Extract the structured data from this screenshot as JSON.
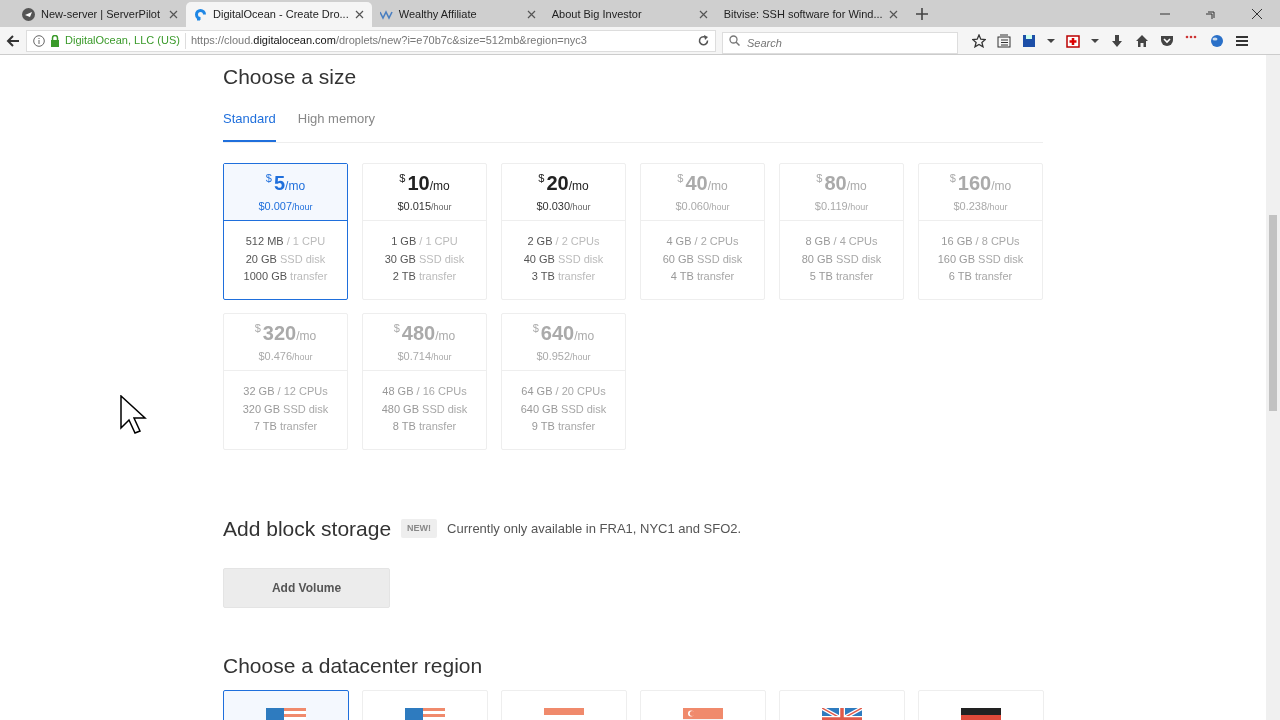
{
  "browser": {
    "tabs": [
      {
        "title": "New-server | ServerPilot",
        "selected": false
      },
      {
        "title": "DigitalOcean - Create Dro...",
        "selected": true
      },
      {
        "title": "Wealthy Affiliate",
        "selected": false
      },
      {
        "title": "About Big Investor",
        "selected": false
      },
      {
        "title": "Bitvise: SSH software for Wind...",
        "selected": false
      }
    ],
    "identity": "DigitalOcean, LLC (US)",
    "url": {
      "prefix": "https://cloud.",
      "domain": "digitalocean.com",
      "path": "/droplets/new?i=e70b7c&size=512mb&region=nyc3"
    },
    "search": {
      "placeholder": "Search"
    }
  },
  "size_section": {
    "title": "Choose a size",
    "tabs": [
      {
        "label": "Standard",
        "selected": true
      },
      {
        "label": "High memory",
        "selected": false
      }
    ],
    "plans": [
      {
        "currency": "$",
        "amount": "5",
        "period": "/mo",
        "hourly": "$0.007",
        "hourly_unit": "/hour",
        "specs": [
          [
            "512 MB",
            "/ 1 CPU"
          ],
          [
            "20 GB",
            "SSD disk"
          ],
          [
            "1000 GB",
            "transfer"
          ]
        ],
        "selected": true,
        "disabled": false
      },
      {
        "currency": "$",
        "amount": "10",
        "period": "/mo",
        "hourly": "$0.015",
        "hourly_unit": "/hour",
        "specs": [
          [
            "1 GB",
            "/ 1 CPU"
          ],
          [
            "30 GB",
            "SSD disk"
          ],
          [
            "2 TB",
            "transfer"
          ]
        ],
        "selected": false,
        "disabled": false
      },
      {
        "currency": "$",
        "amount": "20",
        "period": "/mo",
        "hourly": "$0.030",
        "hourly_unit": "/hour",
        "specs": [
          [
            "2 GB",
            "/ 2 CPUs"
          ],
          [
            "40 GB",
            "SSD disk"
          ],
          [
            "3 TB",
            "transfer"
          ]
        ],
        "selected": false,
        "disabled": false
      },
      {
        "currency": "$",
        "amount": "40",
        "period": "/mo",
        "hourly": "$0.060",
        "hourly_unit": "/hour",
        "specs": [
          [
            "4 GB",
            "/ 2 CPUs"
          ],
          [
            "60 GB",
            "SSD disk"
          ],
          [
            "4 TB",
            "transfer"
          ]
        ],
        "selected": false,
        "disabled": true
      },
      {
        "currency": "$",
        "amount": "80",
        "period": "/mo",
        "hourly": "$0.119",
        "hourly_unit": "/hour",
        "specs": [
          [
            "8 GB",
            "/ 4 CPUs"
          ],
          [
            "80 GB",
            "SSD disk"
          ],
          [
            "5 TB",
            "transfer"
          ]
        ],
        "selected": false,
        "disabled": true
      },
      {
        "currency": "$",
        "amount": "160",
        "period": "/mo",
        "hourly": "$0.238",
        "hourly_unit": "/hour",
        "specs": [
          [
            "16 GB",
            "/ 8 CPUs"
          ],
          [
            "160 GB",
            "SSD disk"
          ],
          [
            "6 TB",
            "transfer"
          ]
        ],
        "selected": false,
        "disabled": true
      },
      {
        "currency": "$",
        "amount": "320",
        "period": "/mo",
        "hourly": "$0.476",
        "hourly_unit": "/hour",
        "specs": [
          [
            "32 GB",
            "/ 12 CPUs"
          ],
          [
            "320 GB",
            "SSD disk"
          ],
          [
            "7 TB",
            "transfer"
          ]
        ],
        "selected": false,
        "disabled": true
      },
      {
        "currency": "$",
        "amount": "480",
        "period": "/mo",
        "hourly": "$0.714",
        "hourly_unit": "/hour",
        "specs": [
          [
            "48 GB",
            "/ 16 CPUs"
          ],
          [
            "480 GB",
            "SSD disk"
          ],
          [
            "8 TB",
            "transfer"
          ]
        ],
        "selected": false,
        "disabled": true
      },
      {
        "currency": "$",
        "amount": "640",
        "period": "/mo",
        "hourly": "$0.952",
        "hourly_unit": "/hour",
        "specs": [
          [
            "64 GB",
            "/ 20 CPUs"
          ],
          [
            "640 GB",
            "SSD disk"
          ],
          [
            "9 TB",
            "transfer"
          ]
        ],
        "selected": false,
        "disabled": true
      }
    ]
  },
  "block_storage": {
    "title": "Add block storage",
    "badge": "NEW!",
    "note": "Currently only available in FRA1, NYC1 and SFO2.",
    "button": "Add Volume"
  },
  "region_section": {
    "title": "Choose a datacenter region",
    "regions": [
      {
        "selected": true
      },
      {
        "selected": false
      },
      {
        "selected": false
      },
      {
        "selected": false
      },
      {
        "selected": false
      },
      {
        "selected": false
      }
    ]
  }
}
